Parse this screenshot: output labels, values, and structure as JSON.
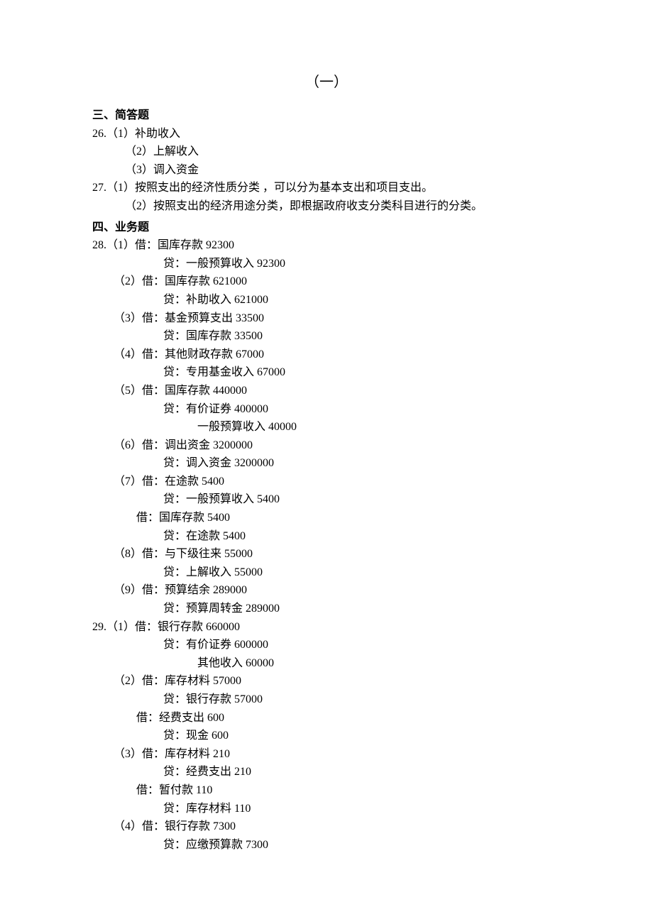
{
  "title": "（一）",
  "section1": {
    "heading": "三、简答题",
    "q26": {
      "num": "26.（1）补助收入",
      "l2": "（2）上解收入",
      "l3": "（3）调入资金"
    },
    "q27": {
      "l1": "27.（1）按照支出的经济性质分类 ，可以分为基本支出和项目支出。",
      "l2": "（2）按照支出的经济用途分类，即根据政府收支分类科目进行的分类。"
    }
  },
  "section2": {
    "heading": "四、业务题",
    "q28": {
      "p1": {
        "l1": "28.（1）借：国库存款 92300",
        "l2": "贷：一般预算收入 92300"
      },
      "p2": {
        "l1": "（2）借：国库存款 621000",
        "l2": "贷：补助收入 621000"
      },
      "p3": {
        "l1": "（3）借：基金预算支出 33500",
        "l2": "贷：国库存款 33500"
      },
      "p4": {
        "l1": "（4）借：其他财政存款 67000",
        "l2": "贷：专用基金收入 67000"
      },
      "p5": {
        "l1": "（5）借：国库存款 440000",
        "l2": "贷：有价证券 400000",
        "l3": "一般预算收入 40000"
      },
      "p6": {
        "l1": "（6）借：调出资金 3200000",
        "l2": "贷：调入资金 3200000"
      },
      "p7": {
        "l1": "（7）借：在途款 5400",
        "l2": "贷：一般预算收入 5400",
        "l3": "借：国库存款 5400",
        "l4": "贷：在途款 5400"
      },
      "p8": {
        "l1": "（8）借：与下级往来 55000",
        "l2": "贷：上解收入 55000"
      },
      "p9": {
        "l1": "（9）借：预算结余 289000",
        "l2": "贷：预算周转金 289000"
      }
    },
    "q29": {
      "p1": {
        "l1": "29.（1）借：银行存款 660000",
        "l2": "贷：有价证券 600000",
        "l3": "其他收入 60000"
      },
      "p2": {
        "l1": "（2）借：库存材料 57000",
        "l2": "贷：银行存款 57000",
        "l3": "借：经费支出 600",
        "l4": "贷：现金 600"
      },
      "p3": {
        "l1": "（3）借：库存材料 210",
        "l2": "贷：经费支出 210",
        "l3": "借：暂付款 110",
        "l4": "贷：库存材料 110"
      },
      "p4": {
        "l1": "（4）借：银行存款 7300",
        "l2": "贷：应缴预算款 7300"
      }
    }
  }
}
